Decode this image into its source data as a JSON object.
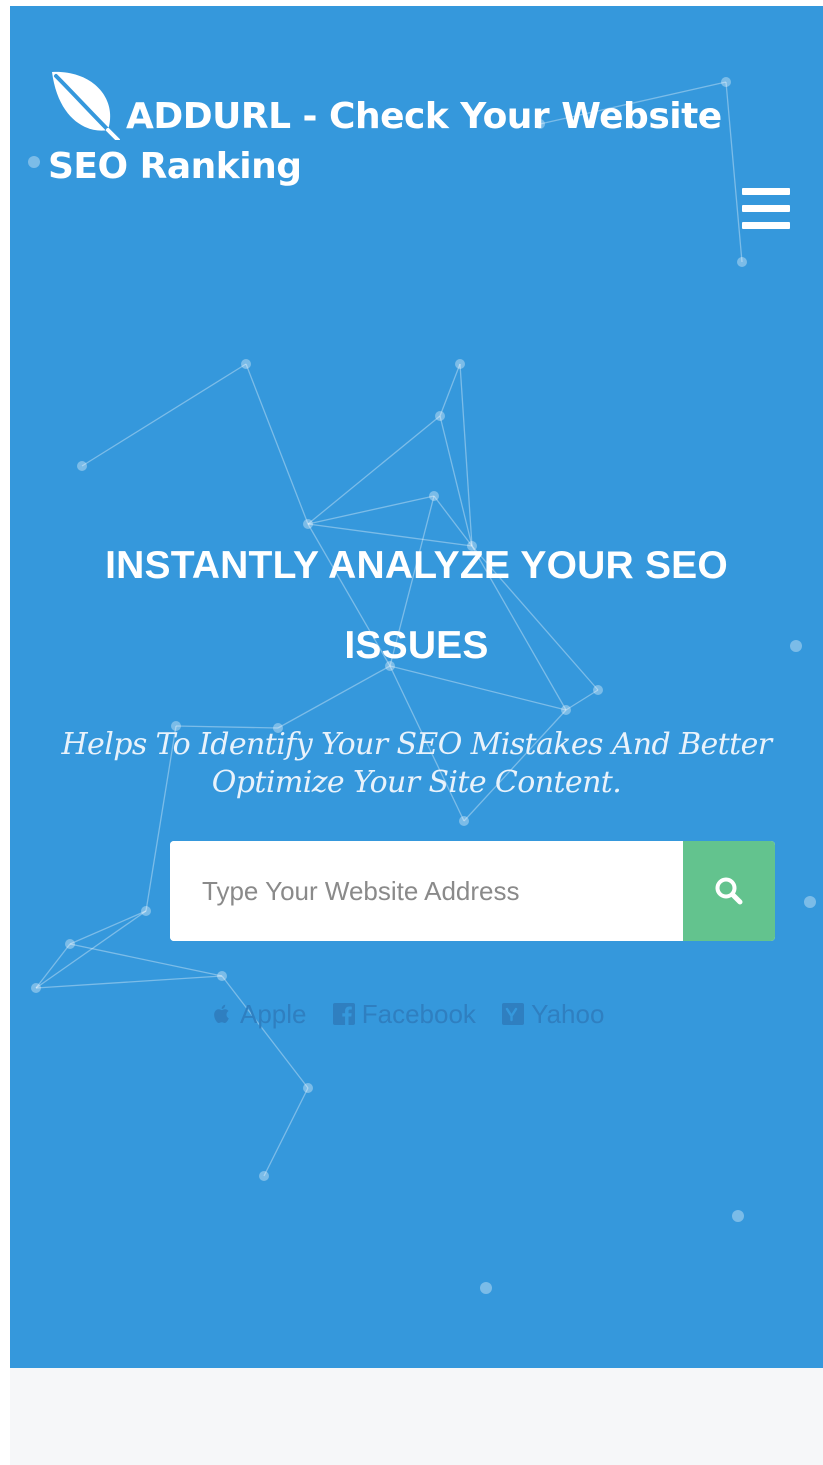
{
  "header": {
    "site_title": "ADDURL - Check Your Website SEO Ranking",
    "logo_icon": "leaf-icon",
    "menu_icon": "hamburger-menu-icon"
  },
  "hero": {
    "headline": "INSTANTLY ANALYZE YOUR SEO ISSUES",
    "subheadline": "Helps To Identify Your SEO Mistakes And Better Optimize Your Site Content.",
    "background_color": "#3598dc"
  },
  "search": {
    "placeholder": "Type Your Website Address",
    "value": "",
    "button_icon": "search-icon",
    "button_color": "#63c38e"
  },
  "examples": [
    {
      "label": "Apple",
      "icon": "apple-icon"
    },
    {
      "label": "Facebook",
      "icon": "facebook-icon"
    },
    {
      "label": "Yahoo",
      "icon": "yahoo-icon"
    }
  ]
}
